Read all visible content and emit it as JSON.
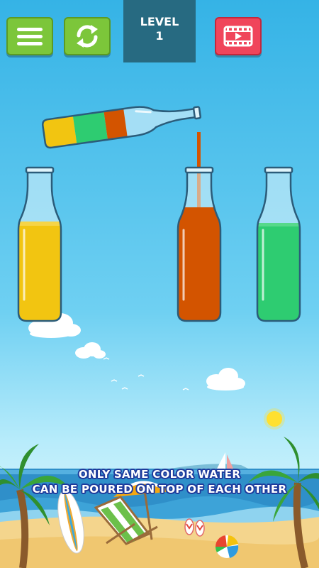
{
  "header": {
    "level_label": "LEVEL",
    "level_number": "1"
  },
  "buttons": {
    "menu": "menu-icon",
    "restart": "restart-icon",
    "video": "video-play-icon"
  },
  "bottles": {
    "pouring": {
      "layers": [
        "yellow",
        "green",
        "orange"
      ]
    },
    "targets": [
      {
        "color": "yellow"
      },
      {
        "color": "orange"
      },
      {
        "color": "green"
      }
    ]
  },
  "colors": {
    "yellow": "#f2c511",
    "green": "#2ecc71",
    "orange": "#d35400",
    "button_green": "#7cc63a",
    "button_red": "#f0455b",
    "level_box": "#276a81",
    "hint_outline": "#1e3b9c"
  },
  "hint": {
    "line1": "ONLY SAME COLOR WATER",
    "line2": "CAN BE POURED ON TOP OF EACH OTHER"
  }
}
